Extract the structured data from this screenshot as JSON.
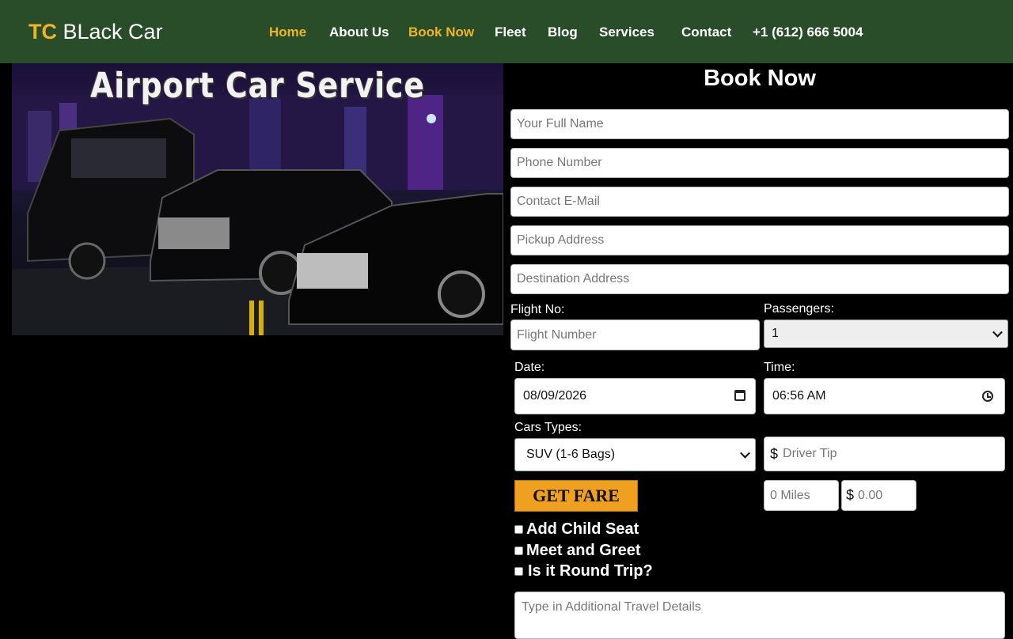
{
  "brand": {
    "prefix": "TC",
    "name": "BLack Car"
  },
  "nav": {
    "home": "Home",
    "about": "About Us",
    "book": "Book Now",
    "fleet": "Fleet",
    "blog": "Blog",
    "services": "Services",
    "contact": "Contact",
    "phone": "+1 (612) 666 5004"
  },
  "hero": {
    "title": "Airport Car Service"
  },
  "form": {
    "title": "Book Now",
    "full_name_placeholder": "Your Full Name",
    "phone_placeholder": "Phone Number",
    "email_placeholder": "Contact E-Mail",
    "pickup_placeholder": "Pickup Address",
    "destination_placeholder": "Destination Address",
    "flight_label": "Flight No:",
    "flight_placeholder": "Flight Number",
    "passengers_label": "Passengers:",
    "passengers_value": "1",
    "date_label": "Date:",
    "date_value": "08/09/2026",
    "time_label": "Time:",
    "time_value": "06:56 AM",
    "car_types_label": "Cars Types:",
    "car_type_value": "SUV (1-6 Bags)",
    "currency_symbol": "$",
    "tip_placeholder": "Driver Tip",
    "get_fare": "GET FARE",
    "miles_placeholder": "0 Miles",
    "price_placeholder": "0.00",
    "child_seat": "Add Child Seat",
    "meet_greet": "Meet and Greet",
    "round_trip": "Is it Round Trip?",
    "details_placeholder": "Type in Additional Travel Details"
  },
  "colors": {
    "header_bg": "#2a4d29",
    "accent": "#f0b429",
    "button": "#f0a020"
  }
}
